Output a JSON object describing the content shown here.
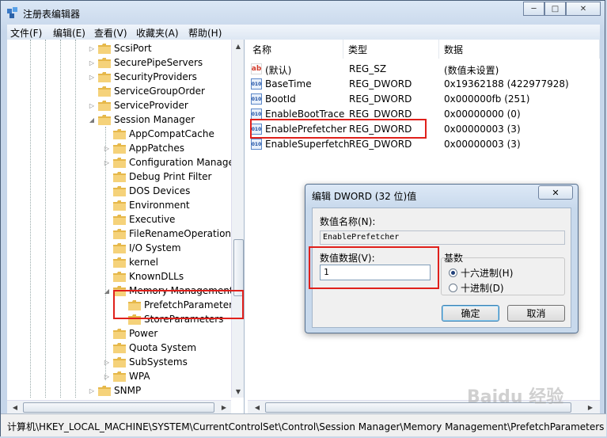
{
  "window": {
    "title": "注册表编辑器",
    "minimize": "─",
    "maximize": "□",
    "close": "✕"
  },
  "menu": [
    "文件(F)",
    "编辑(E)",
    "查看(V)",
    "收藏夹(A)",
    "帮助(H)"
  ],
  "tree": [
    {
      "label": "ScsiPort",
      "expander": "▷"
    },
    {
      "label": "SecurePipeServers",
      "expander": "▷"
    },
    {
      "label": "SecurityProviders",
      "expander": "▷"
    },
    {
      "label": "ServiceGroupOrder",
      "expander": ""
    },
    {
      "label": "ServiceProvider",
      "expander": "▷"
    },
    {
      "label": "Session Manager",
      "expander": "◢"
    },
    {
      "label": "AppCompatCache",
      "expander": ""
    },
    {
      "label": "AppPatches",
      "expander": "▷"
    },
    {
      "label": "Configuration Manager",
      "expander": "▷"
    },
    {
      "label": "Debug Print Filter",
      "expander": ""
    },
    {
      "label": "DOS Devices",
      "expander": ""
    },
    {
      "label": "Environment",
      "expander": ""
    },
    {
      "label": "Executive",
      "expander": ""
    },
    {
      "label": "FileRenameOperations",
      "expander": ""
    },
    {
      "label": "I/O System",
      "expander": ""
    },
    {
      "label": "kernel",
      "expander": ""
    },
    {
      "label": "KnownDLLs",
      "expander": ""
    },
    {
      "label": "Memory Management",
      "expander": "◢"
    },
    {
      "label": "PrefetchParameters",
      "expander": ""
    },
    {
      "label": "StoreParameters",
      "expander": ""
    },
    {
      "label": "Power",
      "expander": ""
    },
    {
      "label": "Quota System",
      "expander": ""
    },
    {
      "label": "SubSystems",
      "expander": "▷"
    },
    {
      "label": "WPA",
      "expander": "▷"
    },
    {
      "label": "SNMP",
      "expander": "▷"
    }
  ],
  "list": {
    "headers": [
      "名称",
      "类型",
      "数据"
    ],
    "rows": [
      {
        "icon": "ab",
        "name": "(默认)",
        "type": "REG_SZ",
        "data": "(数值未设置)"
      },
      {
        "icon": "010",
        "name": "BaseTime",
        "type": "REG_DWORD",
        "data": "0x19362188 (422977928)"
      },
      {
        "icon": "010",
        "name": "BootId",
        "type": "REG_DWORD",
        "data": "0x000000fb (251)"
      },
      {
        "icon": "010",
        "name": "EnableBootTrace",
        "type": "REG_DWORD",
        "data": "0x00000000 (0)"
      },
      {
        "icon": "010",
        "name": "EnablePrefetcher",
        "type": "REG_DWORD",
        "data": "0x00000003 (3)"
      },
      {
        "icon": "010",
        "name": "EnableSuperfetch",
        "type": "REG_DWORD",
        "data": "0x00000003 (3)"
      }
    ]
  },
  "dialog": {
    "title": "编辑 DWORD (32 位)值",
    "close": "✕",
    "value_name_label": "数值名称(N):",
    "value_name": "EnablePrefetcher",
    "value_data_label": "数值数据(V):",
    "value_data": "1",
    "base_label": "基数",
    "hex_label": "十六进制(H)",
    "dec_label": "十进制(D)",
    "ok": "确定",
    "cancel": "取消"
  },
  "status": "计算机\\HKEY_LOCAL_MACHINE\\SYSTEM\\CurrentControlSet\\Control\\Session Manager\\Memory Management\\PrefetchParameters",
  "watermark": "Baidu 经验"
}
